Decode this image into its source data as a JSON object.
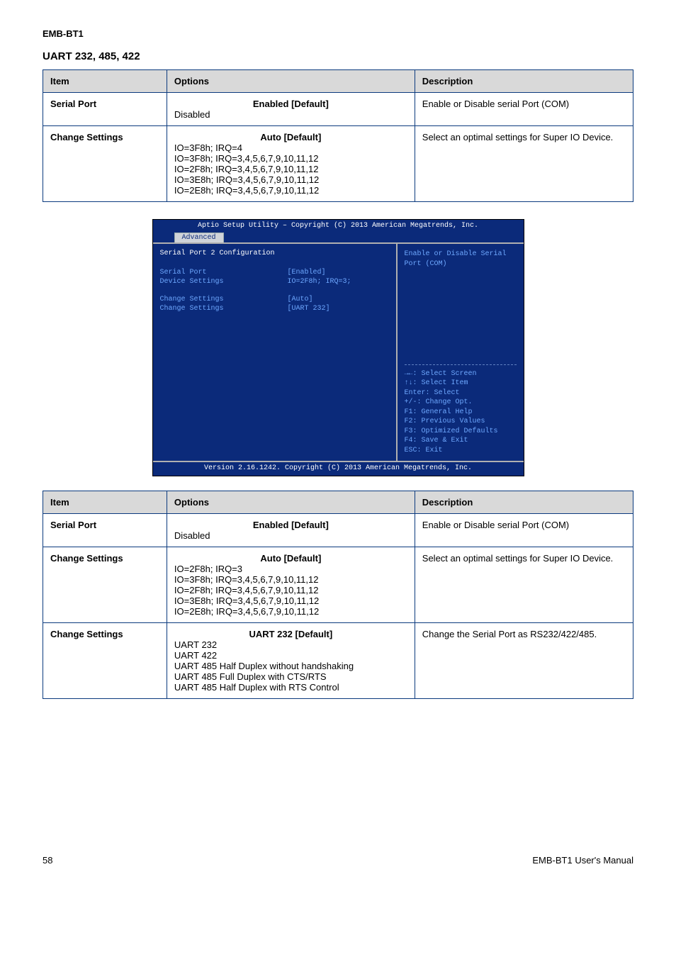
{
  "header": {
    "title": "EMB-BT1",
    "page_top": ""
  },
  "section1": {
    "heading": "UART 232, 485, 422",
    "cols": [
      "Item",
      "Options",
      "Description"
    ],
    "rows": [
      {
        "item": "Serial Port",
        "opt_default": "Enabled [Default]",
        "opts": [
          "Disabled"
        ],
        "desc": "Enable or Disable serial Port (COM)"
      },
      {
        "item": "Change Settings",
        "opt_default": "Auto [Default]",
        "opts": [
          "IO=3F8h; IRQ=4",
          "IO=3F8h; IRQ=3,4,5,6,7,9,10,11,12",
          "IO=2F8h; IRQ=3,4,5,6,7,9,10,11,12",
          "IO=3E8h; IRQ=3,4,5,6,7,9,10,11,12",
          "IO=2E8h; IRQ=3,4,5,6,7,9,10,11,12"
        ],
        "desc": "Select an optimal settings for Super IO Device."
      }
    ]
  },
  "bios": {
    "top_line": "Aptio Setup Utility – Copyright (C) 2013 American Megatrends, Inc.",
    "tab": "Advanced",
    "panel_title": "Serial Port 2 Configuration",
    "rows": [
      {
        "k": "Serial Port",
        "v": "[Enabled]"
      },
      {
        "k": "Device Settings",
        "v": "IO=2F8h; IRQ=3;"
      }
    ],
    "rows2": [
      {
        "k": "Change Settings",
        "v": "[Auto]"
      },
      {
        "k": "Change Settings",
        "v": "[UART 232]"
      }
    ],
    "help_top": "Enable or Disable Serial Port (COM)",
    "help_keys": [
      "→←: Select Screen",
      "↑↓: Select Item",
      "Enter: Select",
      "+/-: Change Opt.",
      "F1: General Help",
      "F2: Previous Values",
      "F3: Optimized Defaults",
      "F4: Save & Exit",
      "ESC: Exit"
    ],
    "bottom_line": "Version 2.16.1242. Copyright (C) 2013 American Megatrends, Inc."
  },
  "section2": {
    "cols": [
      "Item",
      "Options",
      "Description"
    ],
    "rows": [
      {
        "item": "Serial Port",
        "opt_default": "Enabled [Default]",
        "opts": [
          "Disabled"
        ],
        "desc": "Enable or Disable serial Port (COM)"
      },
      {
        "item": "Change Settings",
        "opt_default": "Auto [Default]",
        "opts": [
          "IO=2F8h; IRQ=3",
          "IO=3F8h; IRQ=3,4,5,6,7,9,10,11,12",
          "IO=2F8h; IRQ=3,4,5,6,7,9,10,11,12",
          "IO=3E8h; IRQ=3,4,5,6,7,9,10,11,12",
          "IO=2E8h; IRQ=3,4,5,6,7,9,10,11,12"
        ],
        "desc": "Select an optimal settings for Super IO Device."
      },
      {
        "item": "Change Settings",
        "opt_default": "UART 232 [Default]",
        "opts": [
          "UART 232",
          "UART 422",
          "UART 485 Half Duplex without handshaking",
          "UART 485 Full Duplex with CTS/RTS",
          "UART 485 Half Duplex with RTS Control"
        ],
        "desc": "Change the Serial Port as RS232/422/485."
      }
    ]
  },
  "footer": {
    "page_bottom": "58",
    "manual": "EMB-BT1 User's Manual"
  }
}
